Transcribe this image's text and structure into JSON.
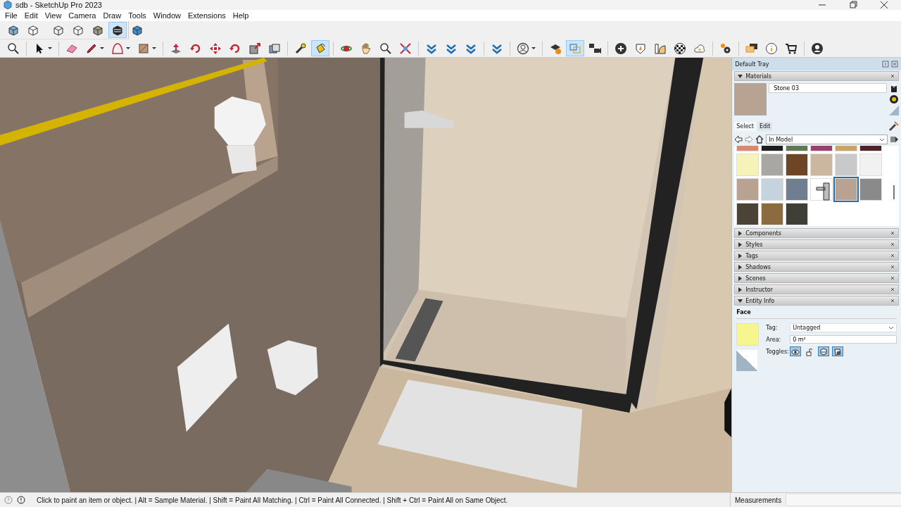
{
  "window": {
    "title": "sdb - SketchUp Pro 2023"
  },
  "menu": [
    "File",
    "Edit",
    "View",
    "Camera",
    "Draw",
    "Tools",
    "Window",
    "Extensions",
    "Help"
  ],
  "style_toolbar": [
    [
      {
        "selected": false
      },
      {
        "selected": false
      }
    ],
    [
      {
        "selected": false
      },
      {
        "selected": false
      },
      {
        "selected": false
      },
      {
        "selected": true
      },
      {
        "selected": false
      }
    ]
  ],
  "main_toolbar": [
    [
      {
        "selected": false,
        "dropdown": false
      }
    ],
    [
      {
        "selected": false,
        "dropdown": true
      }
    ],
    [
      {
        "selected": false,
        "dropdown": false
      },
      {
        "selected": false,
        "dropdown": true
      },
      {
        "selected": false,
        "dropdown": true
      },
      {
        "selected": false,
        "dropdown": true
      }
    ],
    [
      {
        "selected": false,
        "dropdown": false
      },
      {
        "selected": false,
        "dropdown": false
      },
      {
        "selected": false,
        "dropdown": false
      },
      {
        "selected": false,
        "dropdown": false
      },
      {
        "selected": false,
        "dropdown": false
      },
      {
        "selected": false,
        "dropdown": false
      }
    ],
    [
      {
        "selected": false,
        "dropdown": false
      },
      {
        "selected": true,
        "dropdown": false
      }
    ],
    [
      {
        "selected": false,
        "dropdown": false
      },
      {
        "selected": false,
        "dropdown": false
      },
      {
        "selected": false,
        "dropdown": false
      },
      {
        "selected": false,
        "dropdown": false
      }
    ],
    [
      {
        "selected": false,
        "dropdown": false
      },
      {
        "selected": false,
        "dropdown": false
      },
      {
        "selected": false,
        "dropdown": false
      }
    ],
    [
      {
        "selected": false,
        "dropdown": false
      }
    ],
    [
      {
        "selected": false,
        "dropdown": true
      }
    ],
    [
      {
        "selected": false,
        "dropdown": false
      },
      {
        "selected": true,
        "dropdown": false
      },
      {
        "selected": false,
        "dropdown": false
      }
    ],
    [
      {
        "selected": false,
        "dropdown": false
      },
      {
        "selected": false,
        "dropdown": false
      },
      {
        "selected": false,
        "dropdown": false
      },
      {
        "selected": false,
        "dropdown": false
      },
      {
        "selected": false,
        "dropdown": false
      }
    ],
    [
      {
        "selected": false,
        "dropdown": false
      }
    ],
    [
      {
        "selected": false,
        "dropdown": false
      },
      {
        "selected": false,
        "dropdown": false
      },
      {
        "selected": false,
        "dropdown": false
      }
    ],
    [
      {
        "selected": false,
        "dropdown": false
      }
    ]
  ],
  "tray": {
    "title": "Default Tray",
    "materials": {
      "title": "Materials",
      "expanded": true,
      "name": "Stone 03",
      "tabs": [
        {
          "label": "Select",
          "selected": true
        },
        {
          "label": "Edit",
          "selected": false
        }
      ],
      "collection": "In Model",
      "swatches": [
        {
          "kind": "color",
          "color": "#d98a6e",
          "selected": false
        },
        {
          "kind": "color",
          "color": "#1c1c1c",
          "selected": false
        },
        {
          "kind": "color",
          "color": "#5e7a55",
          "selected": false
        },
        {
          "kind": "color",
          "color": "#9a3f6c",
          "selected": false
        },
        {
          "kind": "color",
          "color": "#c9a46a",
          "selected": false
        },
        {
          "kind": "color",
          "color": "#4a2228",
          "selected": false
        },
        {
          "kind": "color",
          "color": "#f5f3b8",
          "selected": false
        },
        {
          "kind": "color",
          "color": "#a9a7a3",
          "selected": false
        },
        {
          "kind": "color",
          "color": "#6e4526",
          "selected": false
        },
        {
          "kind": "color",
          "color": "#cbb79f",
          "selected": false
        },
        {
          "kind": "color",
          "color": "#c9c9c9",
          "selected": false
        },
        {
          "kind": "color",
          "color": "#f1f1f1",
          "selected": false
        },
        {
          "kind": "color",
          "color": "#b8a392",
          "selected": false
        },
        {
          "kind": "color",
          "color": "#c5d3de",
          "selected": false
        },
        {
          "kind": "color",
          "color": "#6f7f91",
          "selected": false
        },
        {
          "kind": "thumbnail",
          "selected": false
        },
        {
          "kind": "color",
          "color": "#b8a392",
          "selected": true
        },
        {
          "kind": "color",
          "color": "#8a8a8a",
          "selected": false
        },
        {
          "kind": "color",
          "color": "#4b4436",
          "selected": false
        },
        {
          "kind": "color",
          "color": "#8d6b40",
          "selected": false
        },
        {
          "kind": "color",
          "color": "#3f3f38",
          "selected": false
        }
      ]
    },
    "panels": [
      {
        "title": "Components",
        "expanded": false
      },
      {
        "title": "Styles",
        "expanded": false
      },
      {
        "title": "Tags",
        "expanded": false
      },
      {
        "title": "Shadows",
        "expanded": false
      },
      {
        "title": "Scenes",
        "expanded": false
      },
      {
        "title": "Instructor",
        "expanded": false
      },
      {
        "title": "Entity Info",
        "expanded": true
      }
    ],
    "entity_info": {
      "type": "Face",
      "fields": [
        {
          "kind": "dropdown",
          "label": "Tag:",
          "value": "Untagged"
        },
        {
          "kind": "text",
          "label": "Area:",
          "value": "0 m²"
        }
      ],
      "toggles_label": "Toggles:",
      "toggles": [
        {
          "on": true
        },
        {
          "on": false
        },
        {
          "on": true
        },
        {
          "on": true
        }
      ]
    }
  },
  "status_bar": {
    "hint": "Click to paint an item or object. | Alt = Sample Material. | Shift = Paint All Matching. | Ctrl = Paint All Connected. | Shift + Ctrl = Paint All on Same Object.",
    "measurements_label": "Measurements"
  }
}
